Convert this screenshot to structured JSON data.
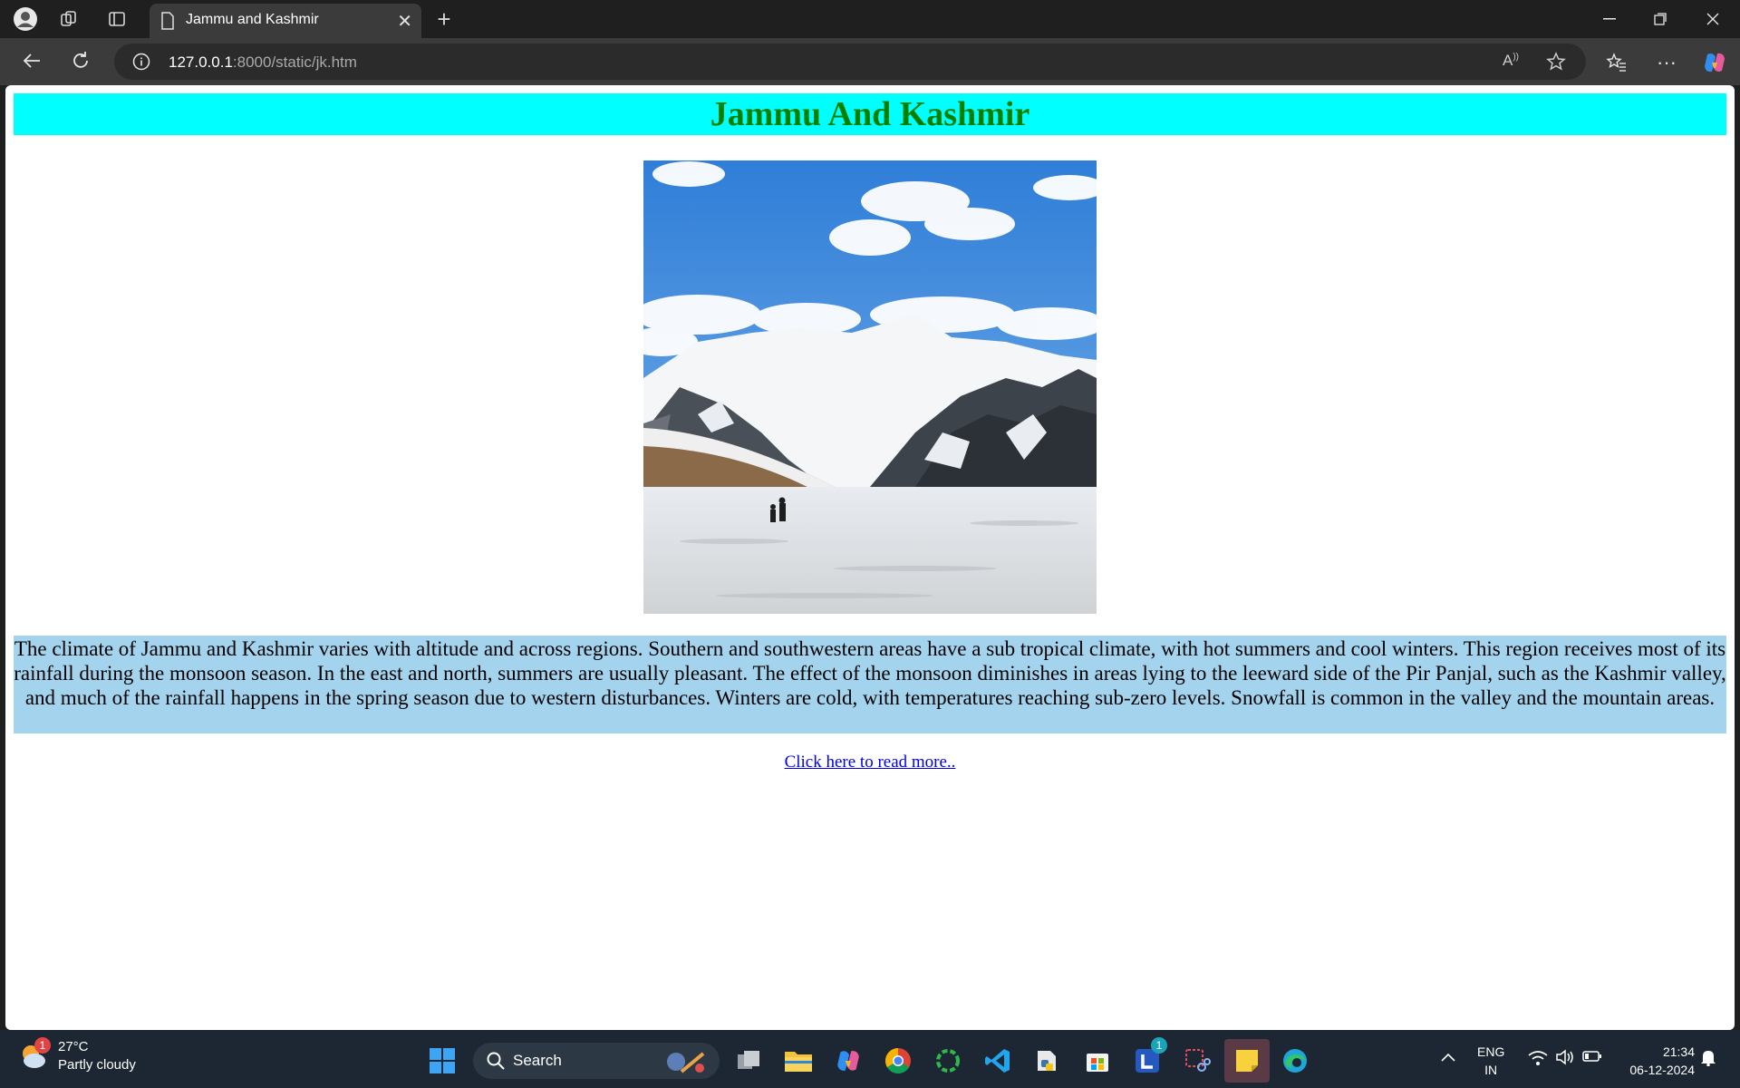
{
  "browser": {
    "tab_title": "Jammu and Kashmir",
    "url_host": "127.0.0.1",
    "url_rest": ":8000/static/jk.htm"
  },
  "page": {
    "heading": "Jammu And Kashmir",
    "paragraph": "The climate of Jammu and Kashmir varies with altitude and across regions. Southern and southwestern areas have a sub tropical climate, with hot summers and cool winters. This region receives most of its rainfall during the monsoon season. In the east and north, summers are usually pleasant. The effect of the monsoon diminishes in areas lying to the leeward side of the Pir Panjal, such as the Kashmir valley, and much of the rainfall happens in the spring season due to western disturbances. Winters are cold, with temperatures reaching sub-zero levels. Snowfall is common in the valley and the mountain areas.",
    "link_text": "Click here to read more..",
    "colors": {
      "heading_bg": "#00ffff",
      "heading_text": "#008000",
      "para_bg": "#a4d3ee",
      "link": "#0000ee"
    }
  },
  "taskbar": {
    "weather_temp": "27°C",
    "weather_desc": "Partly cloudy",
    "weather_badge": "1",
    "search_label": "Search",
    "lang_line1": "ENG",
    "lang_line2": "IN",
    "time": "21:34",
    "date": "06-12-2024",
    "app_badge": "1"
  }
}
